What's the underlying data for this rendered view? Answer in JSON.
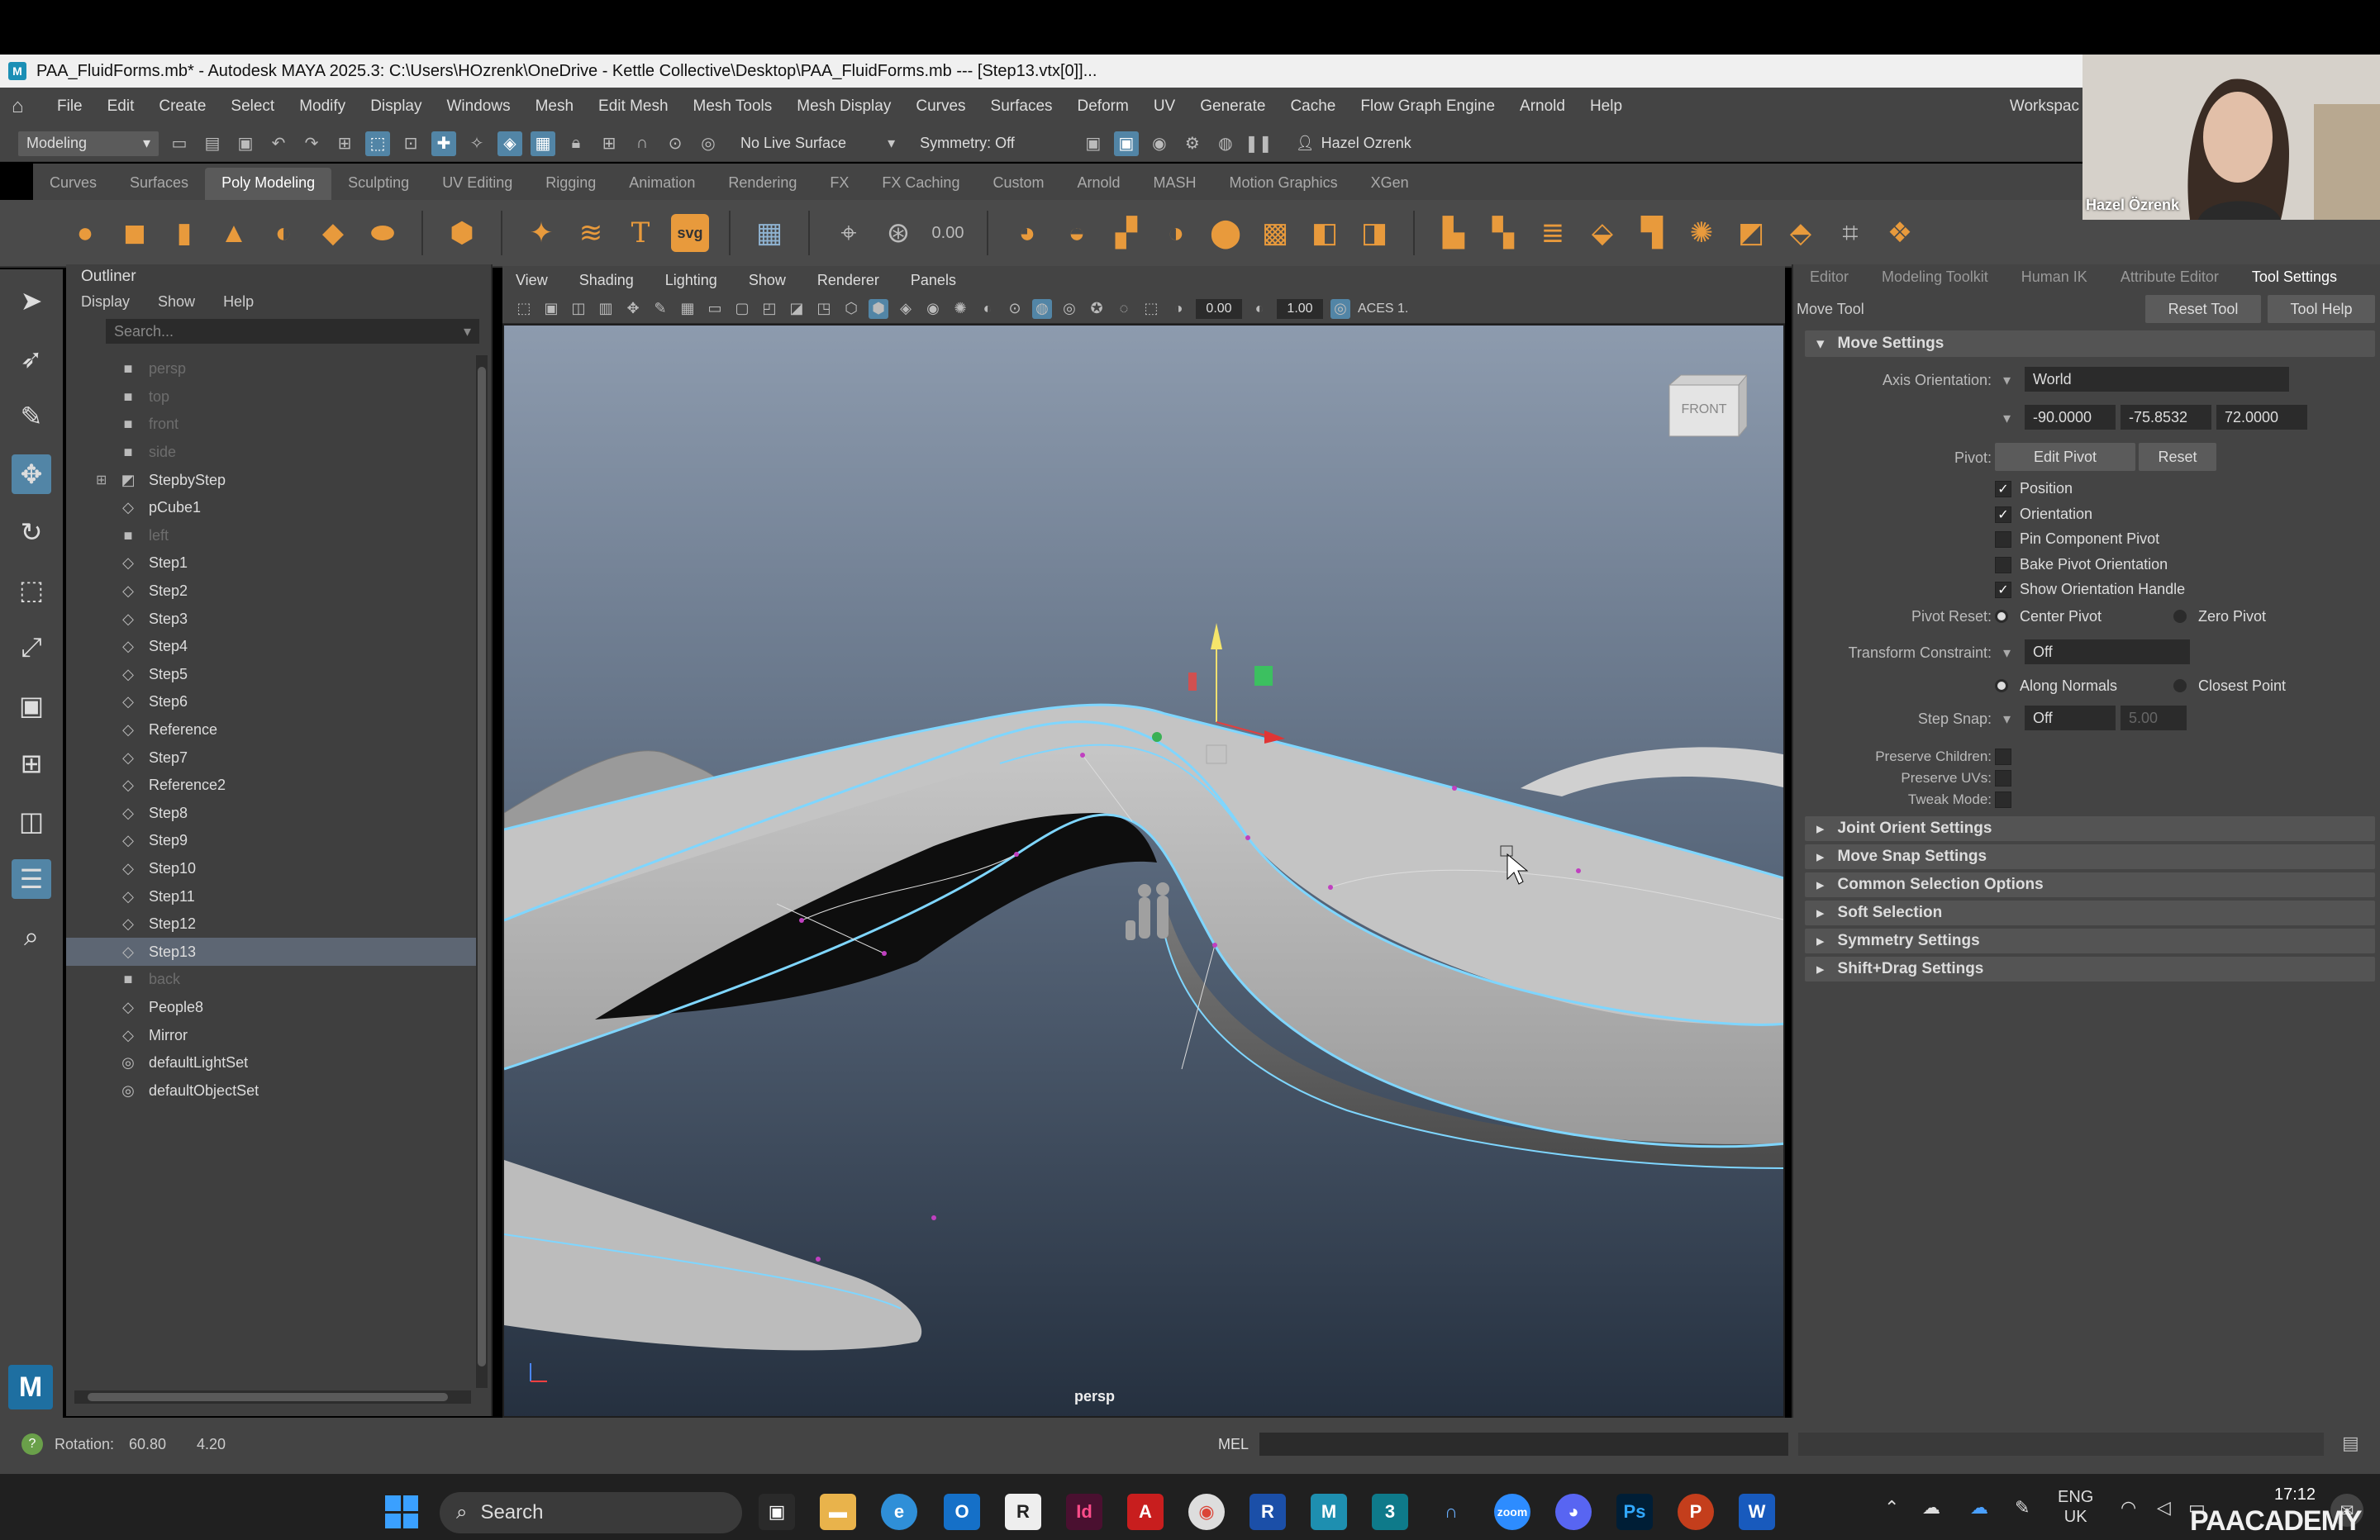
{
  "window": {
    "title": "PAA_FluidForms.mb* - Autodesk MAYA 2025.3: C:\\Users\\HOzrenk\\OneDrive - Kettle Collective\\Desktop\\PAA_FluidForms.mb  ---  [Step13.vtx[0]]..."
  },
  "menubar": [
    "File",
    "Edit",
    "Create",
    "Select",
    "Modify",
    "Display",
    "Windows",
    "Mesh",
    "Edit Mesh",
    "Mesh Tools",
    "Mesh Display",
    "Curves",
    "Surfaces",
    "Deform",
    "UV",
    "Generate",
    "Cache",
    "Flow Graph Engine",
    "Arnold",
    "Help"
  ],
  "menubar_extra": "Workspac",
  "statusline": {
    "mode": "Modeling",
    "live_surface": "No Live Surface",
    "symmetry": "Symmetry: Off",
    "user": "Hazel Ozrenk"
  },
  "shelf_tabs": [
    "Curves",
    "Surfaces",
    "Poly Modeling",
    "Sculpting",
    "UV Editing",
    "Rigging",
    "Animation",
    "Rendering",
    "FX",
    "FX Caching",
    "Custom",
    "Arnold",
    "MASH",
    "Motion Graphics",
    "XGen"
  ],
  "shelf_active": "Poly Modeling",
  "shelf_svg_label": "svg",
  "shelf_value": "0.00",
  "outliner": {
    "title": "Outliner",
    "menus": [
      "Display",
      "Show",
      "Help"
    ],
    "search_placeholder": "Search...",
    "items": [
      {
        "label": "persp",
        "icon": "camera-icon",
        "dim": true
      },
      {
        "label": "top",
        "icon": "camera-icon",
        "dim": true
      },
      {
        "label": "front",
        "icon": "camera-icon",
        "dim": true
      },
      {
        "label": "side",
        "icon": "camera-icon",
        "dim": true
      },
      {
        "label": "StepbyStep",
        "icon": "group-icon",
        "dim": false,
        "expand": true
      },
      {
        "label": "pCube1",
        "icon": "mesh-icon",
        "dim": false
      },
      {
        "label": "left",
        "icon": "camera-icon",
        "dim": true
      },
      {
        "label": "Step1",
        "icon": "mesh-icon",
        "dim": false
      },
      {
        "label": "Step2",
        "icon": "mesh-icon",
        "dim": false
      },
      {
        "label": "Step3",
        "icon": "mesh-icon",
        "dim": false
      },
      {
        "label": "Step4",
        "icon": "mesh-icon",
        "dim": false
      },
      {
        "label": "Step5",
        "icon": "mesh-icon",
        "dim": false
      },
      {
        "label": "Step6",
        "icon": "mesh-icon",
        "dim": false
      },
      {
        "label": "Reference",
        "icon": "mesh-icon",
        "dim": false
      },
      {
        "label": "Step7",
        "icon": "mesh-icon",
        "dim": false
      },
      {
        "label": "Reference2",
        "icon": "mesh-icon",
        "dim": false
      },
      {
        "label": "Step8",
        "icon": "mesh-icon",
        "dim": false
      },
      {
        "label": "Step9",
        "icon": "mesh-icon",
        "dim": false
      },
      {
        "label": "Step10",
        "icon": "mesh-icon",
        "dim": false
      },
      {
        "label": "Step11",
        "icon": "mesh-icon",
        "dim": false
      },
      {
        "label": "Step12",
        "icon": "mesh-icon",
        "dim": false
      },
      {
        "label": "Step13",
        "icon": "mesh-icon",
        "dim": false,
        "selected": true
      },
      {
        "label": "back",
        "icon": "camera-icon",
        "dim": true
      },
      {
        "label": "People8",
        "icon": "mesh-icon",
        "dim": false
      },
      {
        "label": "Mirror",
        "icon": "mesh-icon",
        "dim": false
      },
      {
        "label": "defaultLightSet",
        "icon": "set-icon",
        "dim": false
      },
      {
        "label": "defaultObjectSet",
        "icon": "set-icon",
        "dim": false
      }
    ]
  },
  "viewport": {
    "menus": [
      "View",
      "Shading",
      "Lighting",
      "Show",
      "Renderer",
      "Panels"
    ],
    "field1": "0.00",
    "field2": "1.00",
    "colorspace": "ACES 1.",
    "camera_label": "persp",
    "viewcube_label": "FRONT"
  },
  "right_panel": {
    "tabs": [
      "Editor",
      "Modeling Toolkit",
      "Human IK",
      "Attribute Editor",
      "Tool Settings"
    ],
    "active_tab": "Tool Settings",
    "tool_name": "Move Tool",
    "reset_tool": "Reset Tool",
    "tool_help": "Tool Help",
    "move_settings": "Move Settings",
    "axis_orientation_label": "Axis Orientation:",
    "axis_orientation": "World",
    "axis_values": [
      "-90.0000",
      "-75.8532",
      "72.0000"
    ],
    "pivot_label": "Pivot:",
    "edit_pivot": "Edit Pivot",
    "reset": "Reset",
    "checkboxes": [
      {
        "label": "Position",
        "checked": true
      },
      {
        "label": "Orientation",
        "checked": true
      },
      {
        "label": "Pin Component Pivot",
        "checked": false
      },
      {
        "label": "Bake Pivot Orientation",
        "checked": false
      },
      {
        "label": "Show Orientation Handle",
        "checked": true
      }
    ],
    "pivot_reset_label": "Pivot Reset:",
    "center_pivot": "Center Pivot",
    "zero_pivot": "Zero Pivot",
    "transform_constraint_label": "Transform Constraint:",
    "transform_constraint": "Off",
    "along_normals": "Along Normals",
    "closest_point": "Closest Point",
    "step_snap_label": "Step Snap:",
    "step_snap": "Off",
    "step_snap_value": "5.00",
    "preserve_children": "Preserve Children:",
    "preserve_uvs": "Preserve UVs:",
    "tweak_mode": "Tweak Mode:",
    "sections": [
      "Joint Orient Settings",
      "Move Snap Settings",
      "Common Selection Options",
      "Soft Selection",
      "Symmetry Settings",
      "Shift+Drag Settings"
    ]
  },
  "bottom": {
    "rotation_label": "Rotation:",
    "rotation_x": "60.80",
    "rotation_y": "4.20",
    "mel": "MEL"
  },
  "taskbar": {
    "search": "Search",
    "lang": "ENG",
    "region": "UK",
    "time": "17:12",
    "watermark": "PAACADEMY"
  },
  "webcam": {
    "name": "Hazel Özrenk"
  }
}
